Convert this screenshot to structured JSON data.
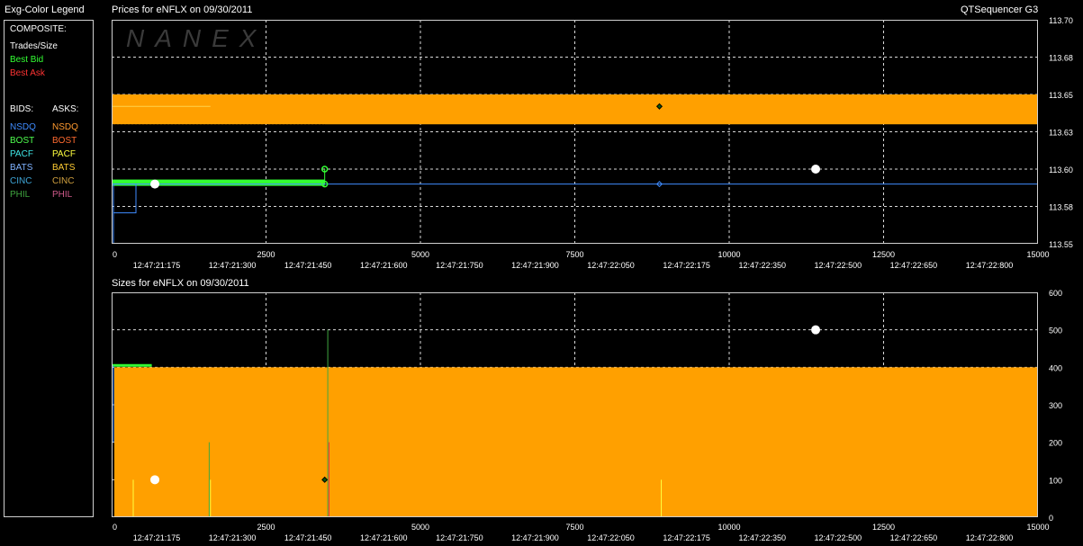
{
  "legend": {
    "title": "Exg-Color Legend",
    "composite_label": "COMPOSITE:",
    "composite": [
      {
        "label": "Trades/Size",
        "color": "#ffffff"
      },
      {
        "label": "Best Bid",
        "color": "#33ff33"
      },
      {
        "label": "Best Ask",
        "color": "#ff3333"
      }
    ],
    "bids_label": "BIDS:",
    "asks_label": "ASKS:",
    "bids": [
      {
        "label": "NSDQ",
        "color": "#3f8cff"
      },
      {
        "label": "BOST",
        "color": "#4fff4f"
      },
      {
        "label": "PACF",
        "color": "#3fe6e6"
      },
      {
        "label": "BATS",
        "color": "#7fb2ff"
      },
      {
        "label": "CINC",
        "color": "#3fa6d8"
      },
      {
        "label": "PHIL",
        "color": "#3fa63f"
      }
    ],
    "asks": [
      {
        "label": "NSDQ",
        "color": "#ff9a2f"
      },
      {
        "label": "BOST",
        "color": "#ff6a2f"
      },
      {
        "label": "PACF",
        "color": "#ffff3f"
      },
      {
        "label": "BATS",
        "color": "#ffcc33"
      },
      {
        "label": "CINC",
        "color": "#d0a03f"
      },
      {
        "label": "PHIL",
        "color": "#d05a8c"
      }
    ]
  },
  "header": {
    "app_title": "QTSequencer G3",
    "watermark": "NANEX"
  },
  "colors": {
    "ask_fill": "#ffa000",
    "bid_green": "#33ff33",
    "nsdq_bid": "#3f8cff",
    "trade": "#ffffff",
    "grid": "#d8d8d8"
  },
  "chart_data": [
    {
      "type": "line",
      "title": "Prices for  eNFLX  on  09/30/2011",
      "x_ticks": [
        "0",
        "2500",
        "5000",
        "7500",
        "10000",
        "12500",
        "15000"
      ],
      "x_range": [
        0,
        15000
      ],
      "time_labels": [
        "12:47:21:175",
        "12:47:21:300",
        "12:47:21:450",
        "12:47:21:600",
        "12:47:21:750",
        "12:47:21:900",
        "12:47:22:050",
        "12:47:22:175",
        "12:47:22:350",
        "12:47:22:500",
        "12:47:22:650",
        "12:47:22:800"
      ],
      "y_ticks": [
        "113.70",
        "113.68",
        "113.65",
        "113.63",
        "113.60",
        "113.58",
        "113.55"
      ],
      "ylim": [
        113.55,
        113.7
      ],
      "grid": true,
      "series": [
        {
          "name": "Best Ask",
          "kind": "step",
          "x": [
            0,
            15000
          ],
          "y": [
            113.65,
            113.65
          ],
          "lower": 113.63
        },
        {
          "name": "Best Bid",
          "kind": "step",
          "x": [
            0,
            3450
          ],
          "y": [
            113.59,
            113.59
          ]
        },
        {
          "name": "NSDQ",
          "kind": "step",
          "x": [
            0,
            3450,
            15000
          ],
          "y": [
            113.59,
            113.59,
            113.59
          ]
        }
      ],
      "trades": [
        {
          "x": 700,
          "y": 113.59
        },
        {
          "x": 11400,
          "y": 113.6
        }
      ]
    },
    {
      "type": "area",
      "title": "Sizes for  eNFLX  on  09/30/2011",
      "x_ticks": [
        "0",
        "2500",
        "5000",
        "7500",
        "10000",
        "12500",
        "15000"
      ],
      "x_range": [
        0,
        15000
      ],
      "time_labels": [
        "12:47:21:175",
        "12:47:21:300",
        "12:47:21:450",
        "12:47:21:600",
        "12:47:21:750",
        "12:47:21:900",
        "12:47:22:050",
        "12:47:22:175",
        "12:47:22:350",
        "12:47:22:500",
        "12:47:22:650",
        "12:47:22:800"
      ],
      "y_ticks": [
        "600",
        "500",
        "400",
        "300",
        "200",
        "100",
        "0"
      ],
      "ylim": [
        0,
        600
      ],
      "grid": true,
      "series": [
        {
          "name": "Best Ask",
          "x": [
            0,
            15000
          ],
          "values": [
            400,
            400
          ]
        },
        {
          "name": "Best Bid",
          "x": [
            0,
            650
          ],
          "values": [
            405,
            405
          ]
        }
      ],
      "spikes": [
        {
          "x": 350,
          "value": 100
        },
        {
          "x": 1600,
          "value": 100
        },
        {
          "x": 1580,
          "value": 200
        },
        {
          "x": 3500,
          "value": 500
        },
        {
          "x": 3520,
          "value": 200
        },
        {
          "x": 8900,
          "value": 100
        }
      ],
      "trades": [
        {
          "x": 700,
          "value": 100
        },
        {
          "x": 11400,
          "value": 500
        }
      ]
    }
  ]
}
